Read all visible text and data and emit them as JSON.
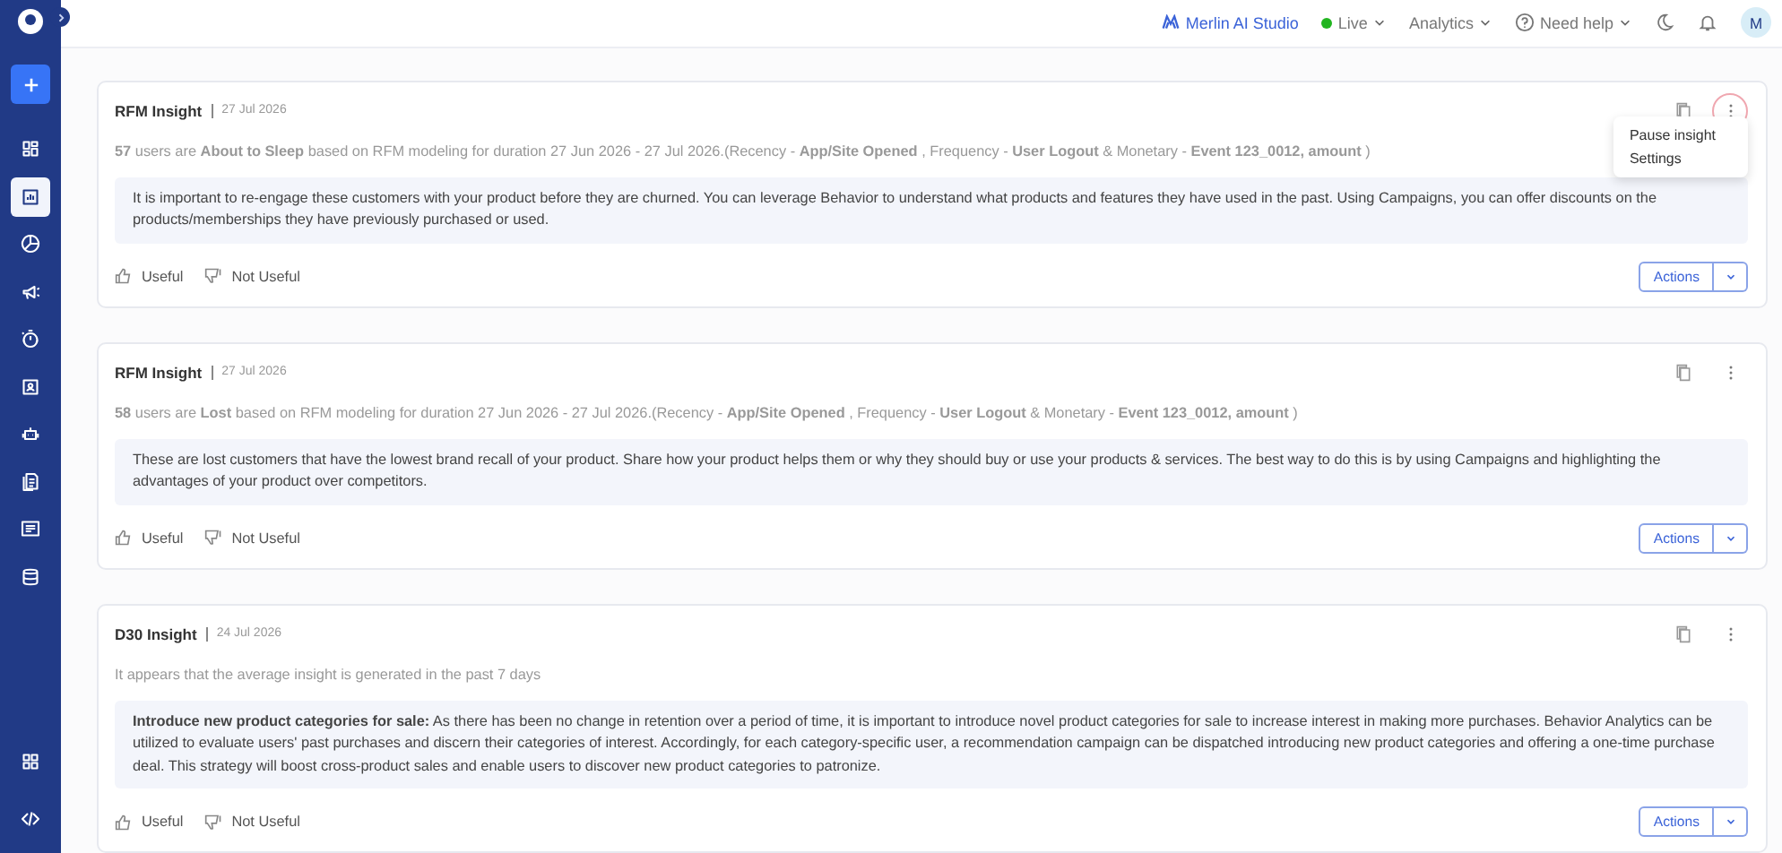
{
  "sidebar": {
    "items": [
      {
        "selected": false
      },
      {
        "selected": true
      },
      {
        "selected": false
      },
      {
        "selected": false
      },
      {
        "selected": false
      },
      {
        "selected": false
      },
      {
        "selected": false
      },
      {
        "selected": false
      },
      {
        "selected": false
      },
      {
        "selected": false
      }
    ],
    "bottom_items": [
      {
        "selected": false
      },
      {
        "selected": false
      }
    ]
  },
  "topbar": {
    "studio": "Merlin AI Studio",
    "environment": "Live",
    "analytics": "Analytics",
    "help": "Need help",
    "avatar": "M"
  },
  "insights": [
    {
      "title": "RFM Insight",
      "date": "27 Jul 2026",
      "summary": "**57** users are **About to Sleep** based on RFM modeling for duration 27 Jun 2026 - 27 Jul 2026.(Recency - **App/Site Opened** , Frequency - **User Logout** & Monetary - **Event 123_0012, amount** )",
      "advice": "It is important to re-engage these customers with your product before they are churned. You can leverage Behavior to understand what products and features they have used in the past. Using Campaigns, you can offer discounts on the products/memberships they have previously purchased or used.",
      "useful": "Useful",
      "not_useful": "Not Useful",
      "actions": "Actions",
      "menu_open": true,
      "menu": [
        "Pause insight",
        "Settings"
      ]
    },
    {
      "title": "RFM Insight",
      "date": "27 Jul 2026",
      "summary": "**58** users are **Lost** based on RFM modeling for duration 27 Jun 2026 - 27 Jul 2026.(Recency - **App/Site Opened** , Frequency - **User Logout** & Monetary - **Event 123_0012, amount** )",
      "advice": "These are lost customers that have the lowest brand recall of your product. Share how your product helps them or why they should buy or use your products & services. The best way to do this is by using Campaigns and highlighting the advantages of your product over competitors.",
      "useful": "Useful",
      "not_useful": "Not Useful",
      "actions": "Actions",
      "menu_open": false
    },
    {
      "title": "D30 Insight",
      "date": "24 Jul 2026",
      "summary": "It appears that the average insight is generated in the past 7 days",
      "advice": "**Introduce new product categories for sale:** As there has been no change in retention over a period of time, it is important to introduce novel product categories for sale to increase interest in making more purchases. Behavior Analytics can be utilized to evaluate users' past purchases and discern their categories of interest. Accordingly, for each category-specific user, a recommendation campaign can be dispatched introducing new product categories and offering a one-time purchase deal. This strategy will boost cross-product sales and enable users to discover new product categories to patronize.",
      "useful": "Useful",
      "not_useful": "Not Useful",
      "actions": "Actions",
      "menu_open": false
    }
  ]
}
